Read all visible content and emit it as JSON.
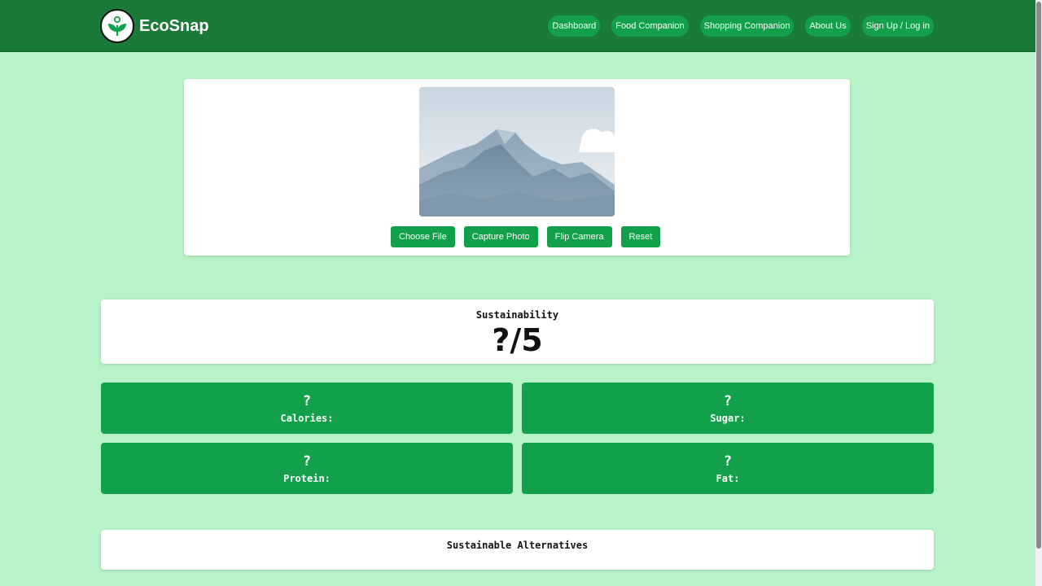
{
  "brand": {
    "name": "EcoSnap",
    "logo_icon": "sprout-in-circle-icon"
  },
  "nav": {
    "items": [
      {
        "label": "Dashboard"
      },
      {
        "label": "Food Companion"
      },
      {
        "label": "Shopping Companion"
      },
      {
        "label": "About Us"
      },
      {
        "label": "Sign Up / Log in"
      }
    ]
  },
  "upload": {
    "preview_icon": "mountain-placeholder-image",
    "buttons": {
      "choose_file": "Choose File",
      "capture_photo": "Capture Photo",
      "flip_camera": "Flip Camera",
      "reset": "Reset"
    }
  },
  "sustainability": {
    "label": "Sustainability",
    "score": "?/5"
  },
  "nutrition": {
    "calories": {
      "value": "?",
      "label": "Calories:"
    },
    "sugar": {
      "value": "?",
      "label": "Sugar:"
    },
    "protein": {
      "value": "?",
      "label": "Protein:"
    },
    "fat": {
      "value": "?",
      "label": "Fat:"
    }
  },
  "alternatives": {
    "title": "Sustainable Alternatives"
  },
  "colors": {
    "background": "#b7f2c8",
    "header": "#1a7a38",
    "accent": "#12a14a"
  }
}
